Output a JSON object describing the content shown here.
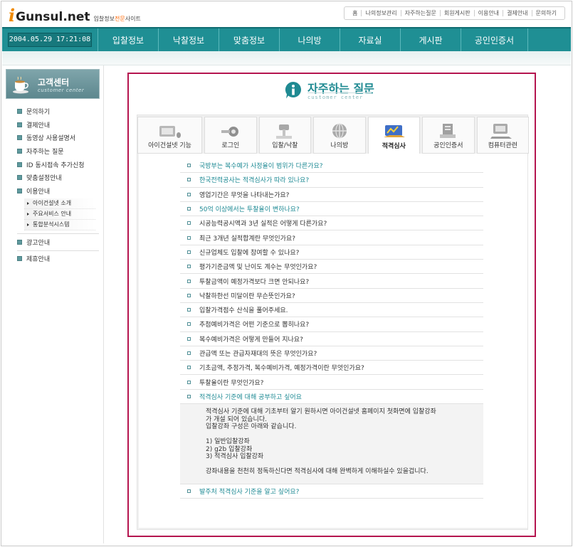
{
  "header": {
    "logo_i": "i",
    "logo_name": "Gunsul.net",
    "tagline_pre": "입찰정보",
    "tagline_em": "전문",
    "tagline_post": "사이트",
    "top_links": [
      "홈",
      "나의정보관리",
      "자주하는질문",
      "회원게시판",
      "이용안내",
      "결제안내",
      "문의하기"
    ]
  },
  "nav": {
    "datetime": "2004.05.29 17:21:08",
    "items": [
      "입찰정보",
      "낙찰정보",
      "맞춤정보",
      "나의방",
      "자료실",
      "게시판",
      "공인인증서"
    ]
  },
  "sidebar": {
    "title": "고객센터",
    "subtitle": "customer center",
    "items": [
      "문의하기",
      "결제안내",
      "동영상 사용설명서",
      "자주하는 질문",
      "ID 동시접속 추가신청",
      "맞춤설정안내",
      "이용안내"
    ],
    "sub_items": [
      "아이건설넷 소개",
      "주요서비스 안내",
      "통합분석시스템"
    ],
    "bottom_items": [
      "광고안내",
      "제휴안내"
    ]
  },
  "main": {
    "title": "자주하는 질문",
    "subtitle": "customer center",
    "tabs": [
      "아이건설넷 기능",
      "로그인",
      "입찰/낙찰",
      "나의방",
      "적격심사",
      "공인인증서",
      "컴퓨터관련"
    ],
    "active_tab": 4,
    "faqs": [
      {
        "q": "국방부는 복수예가 사정율이 범위가 다른가요?",
        "tone": "teal"
      },
      {
        "q": "한국전력공사는 적격심사가 따라 있나요?",
        "tone": "teal"
      },
      {
        "q": "영업기간은 무엇을 나타내는가요?",
        "tone": "dark"
      },
      {
        "q": "50억 이상에서는 투찰율이 변하나요?",
        "tone": "teal"
      },
      {
        "q": "시공능력공시액과 3년 실적은 어떻게 다른가요?",
        "tone": "dark"
      },
      {
        "q": "최근 3개년 실적합계란 무엇인가요?",
        "tone": "dark"
      },
      {
        "q": "신규업체도 입찰에 참여할 수 있나요?",
        "tone": "dark"
      },
      {
        "q": "평가기준금액 및 난이도 계수는 무엇인가요?",
        "tone": "dark"
      },
      {
        "q": "투찰금액이 예정가격보다 크면 안되나요?",
        "tone": "dark"
      },
      {
        "q": "낙찰하한선 미달이란 무슨뜻인가요?",
        "tone": "dark"
      },
      {
        "q": "입찰가격점수 산식을 풀어주세요.",
        "tone": "dark"
      },
      {
        "q": "추첨예비가격은 어떤 기준으로 뽑히나요?",
        "tone": "dark"
      },
      {
        "q": "복수예비가격은 어떻게 만들어 지나요?",
        "tone": "dark"
      },
      {
        "q": "관급액 또는 관급자재대의 뜻은 무엇인가요?",
        "tone": "dark"
      },
      {
        "q": "기초금액, 추정가격, 복수예비가격, 예정가격이란 무엇인가요?",
        "tone": "dark"
      },
      {
        "q": "투찰율이란 무엇인가요?",
        "tone": "dark"
      },
      {
        "q": "적격심사 기준에 대해 공부하고 싶어요",
        "tone": "teal"
      }
    ],
    "answer_lines": [
      "적격심사 기준에 대해 기초부터 알기 원하시면 아이건설넷 홈페이지 첫화면에 입찰강좌",
      "가 개설 되어 있습니다.",
      "입찰강좌 구성은 아래와 같습니다.",
      "",
      "1) 일반입찰강좌",
      "2) g2b 입찰강좌",
      "3) 적격심사 입찰강좌",
      "",
      "강좌내용을 천천히 정독하신다면 적격심사에 대해 완벽하게 이해하실수 있을겁니다."
    ],
    "last_faq": "발주처 적격심사 기준을 알고 싶어요?"
  }
}
